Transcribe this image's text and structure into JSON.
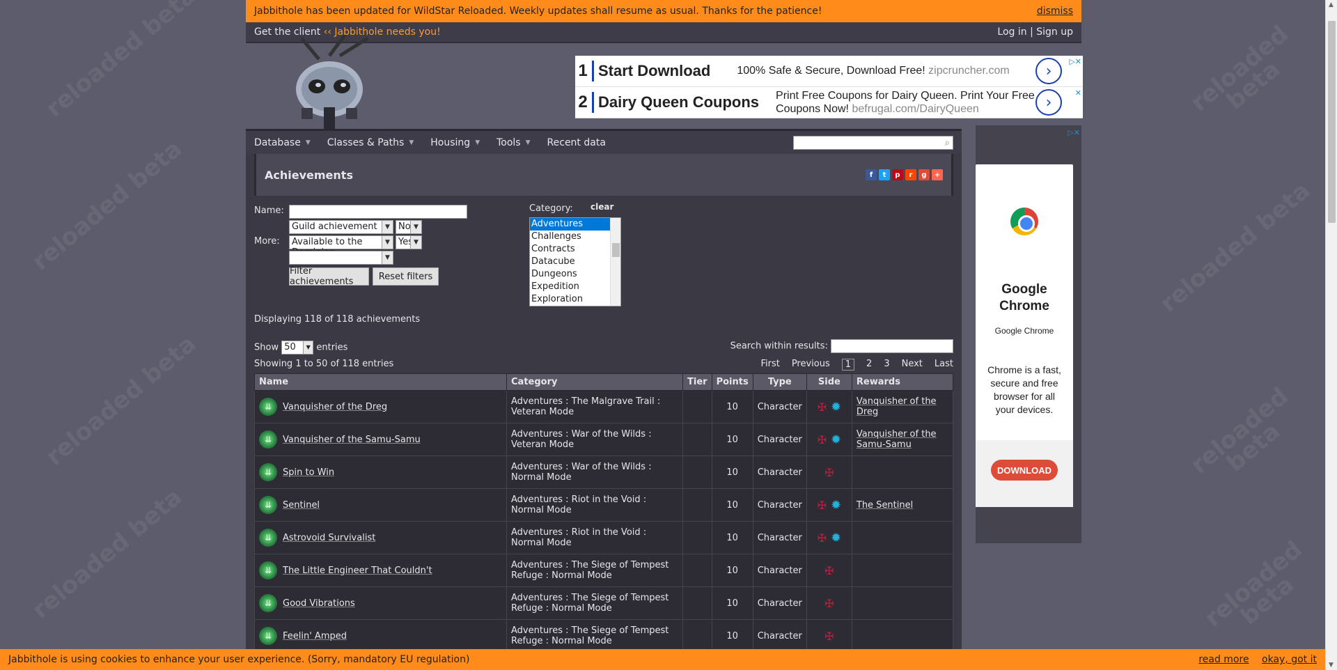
{
  "notice": {
    "text": "Jabbithole has been updated for WildStar Reloaded. Weekly updates shall resume as usual. Thanks for the patience!",
    "dismiss": "dismiss"
  },
  "topbar": {
    "get_client": "Get the client",
    "needs_you": "‹‹ Jabbithole needs you!",
    "login": "Log in",
    "sep": "|",
    "signup": "Sign up"
  },
  "ads": [
    {
      "num": "1",
      "title": "Start Download",
      "desc": "100% Safe & Secure, Download Free!",
      "url": "zipcruncher.com"
    },
    {
      "num": "2",
      "title": "Dairy Queen Coupons",
      "desc": "Print Free Coupons for Dairy Queen. Print Your Free Coupons Now!",
      "url": "befrugal.com/DairyQueen"
    }
  ],
  "nav": {
    "items": [
      "Database",
      "Classes & Paths",
      "Housing",
      "Tools",
      "Recent data"
    ]
  },
  "page": {
    "title": "Achievements"
  },
  "filters": {
    "name_label": "Name:",
    "more_label": "More:",
    "guild": "Guild achievement",
    "guild_val": "No",
    "avail": "Available to the Dominion",
    "avail_val": "Yes",
    "filter_btn": "Filter achievements",
    "reset_btn": "Reset filters",
    "category_label": "Category:",
    "clear": "clear",
    "categories": [
      "Adventures",
      "Challenges",
      "Contracts",
      "Datacube",
      "Dungeons",
      "Expedition",
      "Exploration"
    ]
  },
  "summary": {
    "displaying": "Displaying 118 of 118 achievements",
    "show": "Show",
    "show_val": "50",
    "entries": "entries",
    "search_label": "Search within results:",
    "showing": "Showing 1 to 50 of 118 entries"
  },
  "pager": {
    "first": "First",
    "prev": "Previous",
    "p1": "1",
    "p2": "2",
    "p3": "3",
    "next": "Next",
    "last": "Last"
  },
  "table": {
    "headers": {
      "name": "Name",
      "category": "Category",
      "tier": "Tier",
      "points": "Points",
      "type": "Type",
      "side": "Side",
      "rewards": "Rewards"
    },
    "rows": [
      {
        "name": "Vanquisher of the Dreg",
        "category": "Adventures : The Malgrave Trail : Veteran Mode",
        "tier": "",
        "points": "10",
        "type": "Character",
        "dominion": true,
        "reward": "Vanquisher of the Dreg"
      },
      {
        "name": "Vanquisher of the Samu-Samu",
        "category": "Adventures : War of the Wilds : Veteran Mode",
        "tier": "",
        "points": "10",
        "type": "Character",
        "dominion": true,
        "reward": "Vanquisher of the Samu-Samu"
      },
      {
        "name": "Spin to Win",
        "category": "Adventures : War of the Wilds : Normal Mode",
        "tier": "",
        "points": "10",
        "type": "Character",
        "dominion": false,
        "reward": ""
      },
      {
        "name": "Sentinel",
        "category": "Adventures : Riot in the Void : Normal Mode",
        "tier": "",
        "points": "10",
        "type": "Character",
        "dominion": true,
        "reward": "The Sentinel"
      },
      {
        "name": "Astrovoid Survivalist",
        "category": "Adventures : Riot in the Void : Normal Mode",
        "tier": "",
        "points": "10",
        "type": "Character",
        "dominion": true,
        "reward": ""
      },
      {
        "name": "The Little Engineer That Couldn't",
        "category": "Adventures : The Siege of Tempest Refuge : Normal Mode",
        "tier": "",
        "points": "10",
        "type": "Character",
        "dominion": false,
        "reward": ""
      },
      {
        "name": "Good Vibrations",
        "category": "Adventures : The Siege of Tempest Refuge : Normal Mode",
        "tier": "",
        "points": "10",
        "type": "Character",
        "dominion": false,
        "reward": ""
      },
      {
        "name": "Feelin' Amped",
        "category": "Adventures : The Siege of Tempest Refuge : Normal Mode",
        "tier": "",
        "points": "10",
        "type": "Character",
        "dominion": false,
        "reward": ""
      }
    ]
  },
  "sidebar_ad": {
    "title": "Google Chrome",
    "subtitle": "Google Chrome",
    "desc": "Chrome is a fast, secure and free browser for all your devices.",
    "cta": "DOWNLOAD"
  },
  "cookie": {
    "text": "Jabbithole is using cookies to enhance your user experience. (Sorry, mandatory EU regulation)",
    "read_more": "read more",
    "okay": "okay, got it"
  },
  "watermark": "reloaded beta",
  "colors": {
    "orange": "#ff8c1a",
    "exile": "#b0223a",
    "dominion": "#26b0d8",
    "ad_blue": "#1a3fb0"
  }
}
